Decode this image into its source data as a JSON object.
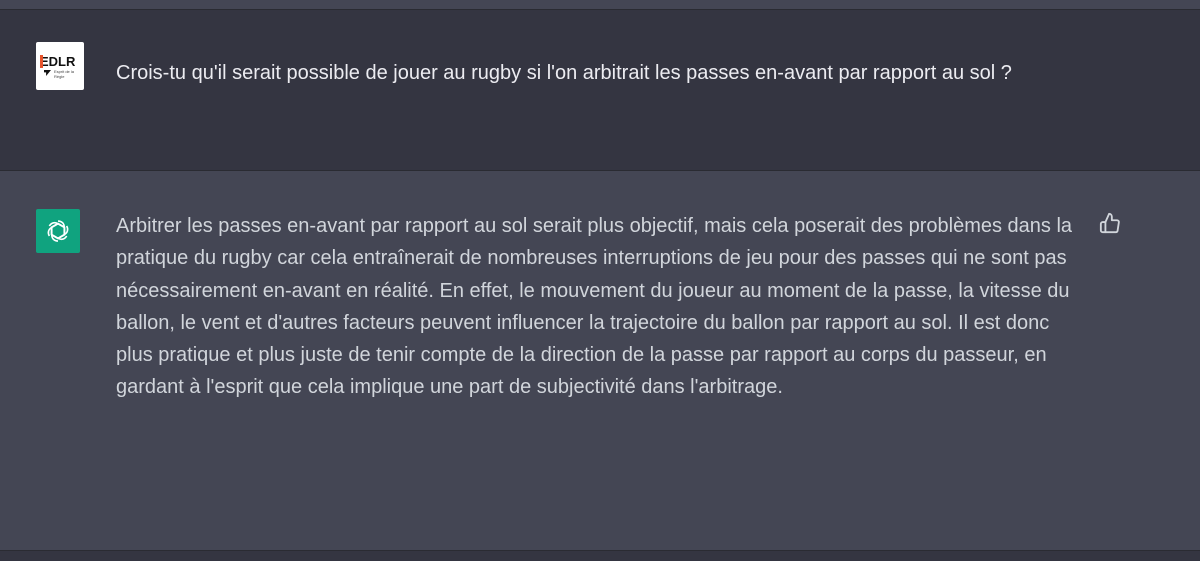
{
  "user_message": {
    "avatar": {
      "logo_text": "EDLR",
      "logo_subtitle": "Esprit de la Règle"
    },
    "text": "Crois-tu qu'il serait possible de jouer au rugby si l'on arbitrait les passes en-avant par rapport au sol ?"
  },
  "assistant_message": {
    "avatar_icon": "openai-logo-icon",
    "text": "Arbitrer les passes en-avant par rapport au sol serait plus objectif, mais cela poserait des problèmes dans la pratique du rugby car cela entraînerait de nombreuses interruptions de jeu pour des passes qui ne sont pas nécessairement en-avant en réalité. En effet, le mouvement du joueur au moment de la passe, la vitesse du ballon, le vent et d'autres facteurs peuvent influencer la trajectoire du ballon par rapport au sol. Il est donc plus pratique et plus juste de tenir compte de la direction de la passe par rapport au corps du passeur, en gardant à l'esprit que cela implique une part de subjectivité dans l'arbitrage.",
    "feedback_icon": "thumbs-up-icon"
  },
  "colors": {
    "user_bg": "#343541",
    "assistant_bg": "#444654",
    "bot_avatar": "#10a37f",
    "user_text": "#ececf1",
    "assistant_text": "#d1d5db",
    "logo_accent": "#e8542c"
  }
}
